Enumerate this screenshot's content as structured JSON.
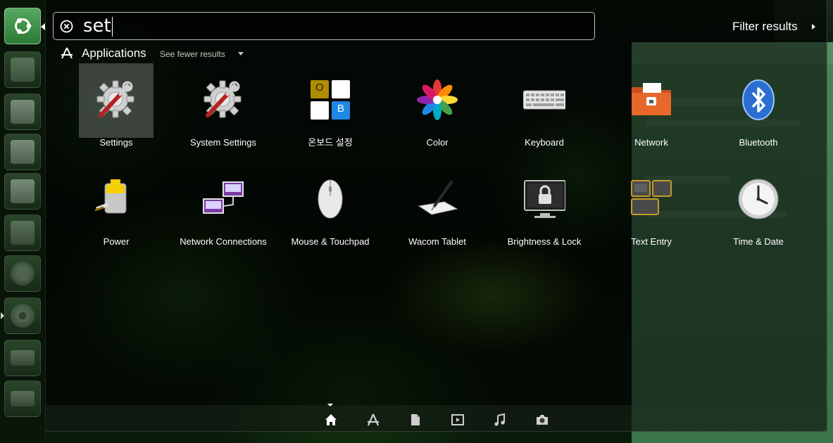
{
  "search": {
    "query": "set"
  },
  "filter": {
    "label": "Filter results"
  },
  "category": {
    "title": "Applications",
    "see_fewer": "See fewer results"
  },
  "apps": [
    {
      "label": "Settings",
      "icon": "settings-gear-wrench-icon"
    },
    {
      "label": "System Settings",
      "icon": "settings-gear-wrench-icon"
    },
    {
      "label": "온보드 설정",
      "icon": "onboard-keyboard-icon",
      "keys": [
        "O",
        "B"
      ]
    },
    {
      "label": "Color",
      "icon": "color-flower-icon"
    },
    {
      "label": "Keyboard",
      "icon": "keyboard-icon"
    },
    {
      "label": "Network",
      "icon": "network-folder-icon"
    },
    {
      "label": "Bluetooth",
      "icon": "bluetooth-icon"
    },
    {
      "label": "Power",
      "icon": "battery-power-icon"
    },
    {
      "label": "Network Connections",
      "icon": "network-connections-icon"
    },
    {
      "label": "Mouse & Touchpad",
      "icon": "mouse-icon"
    },
    {
      "label": "Wacom Tablet",
      "icon": "wacom-tablet-icon"
    },
    {
      "label": "Brightness & Lock",
      "icon": "brightness-lock-icon"
    },
    {
      "label": "Text Entry",
      "icon": "text-entry-icon"
    },
    {
      "label": "Time & Date",
      "icon": "clock-icon"
    }
  ],
  "launcher": [
    "ubuntu-logo-icon",
    "files-icon",
    "writer-icon",
    "calc-icon",
    "impress-icon",
    "software-center-icon",
    "system-settings-icon",
    "disc-icon",
    "drive-icon",
    "drive-icon"
  ],
  "lenses": [
    "home-lens-icon",
    "applications-lens-icon",
    "files-lens-icon",
    "video-lens-icon",
    "music-lens-icon",
    "photo-lens-icon"
  ],
  "colors": {
    "accent": "#2e7d32",
    "bluetooth": "#2a6fd0",
    "onboard_o": "#c8a200",
    "onboard_b": "#1e88e5"
  }
}
